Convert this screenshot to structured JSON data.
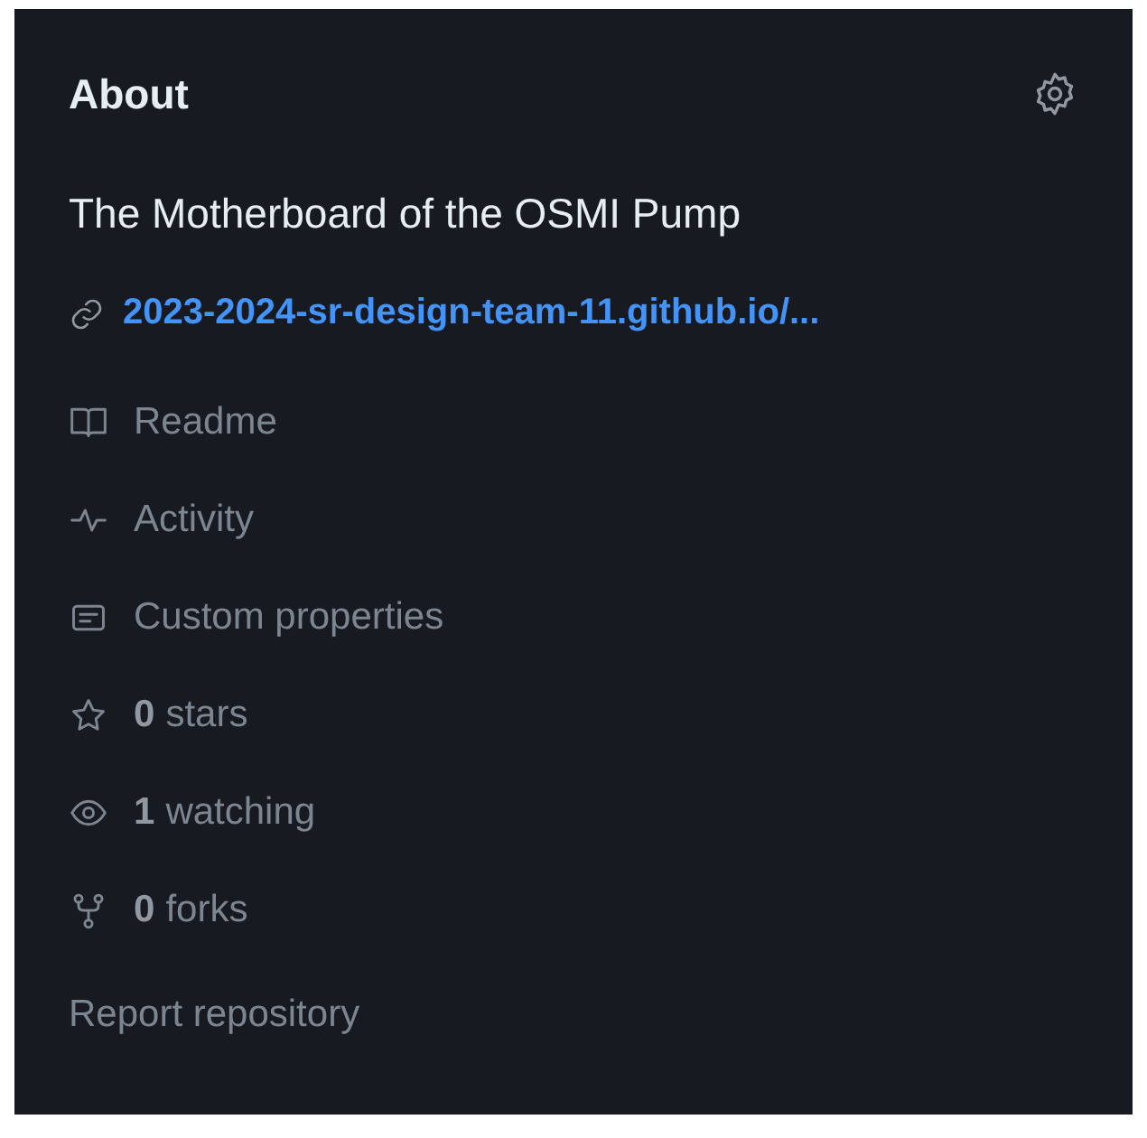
{
  "title": "About",
  "description": "The Motherboard of the OSMI Pump",
  "website": "2023-2024-sr-design-team-11.github.io/...",
  "links": [
    {
      "kind": "plain",
      "label": "Readme"
    },
    {
      "kind": "plain",
      "label": "Activity"
    },
    {
      "kind": "plain",
      "label": "Custom properties"
    },
    {
      "kind": "stat",
      "count": "0",
      "label": "stars"
    },
    {
      "kind": "stat",
      "count": "1",
      "label": "watching"
    },
    {
      "kind": "stat",
      "count": "0",
      "label": "forks"
    }
  ],
  "report": "Report repository"
}
